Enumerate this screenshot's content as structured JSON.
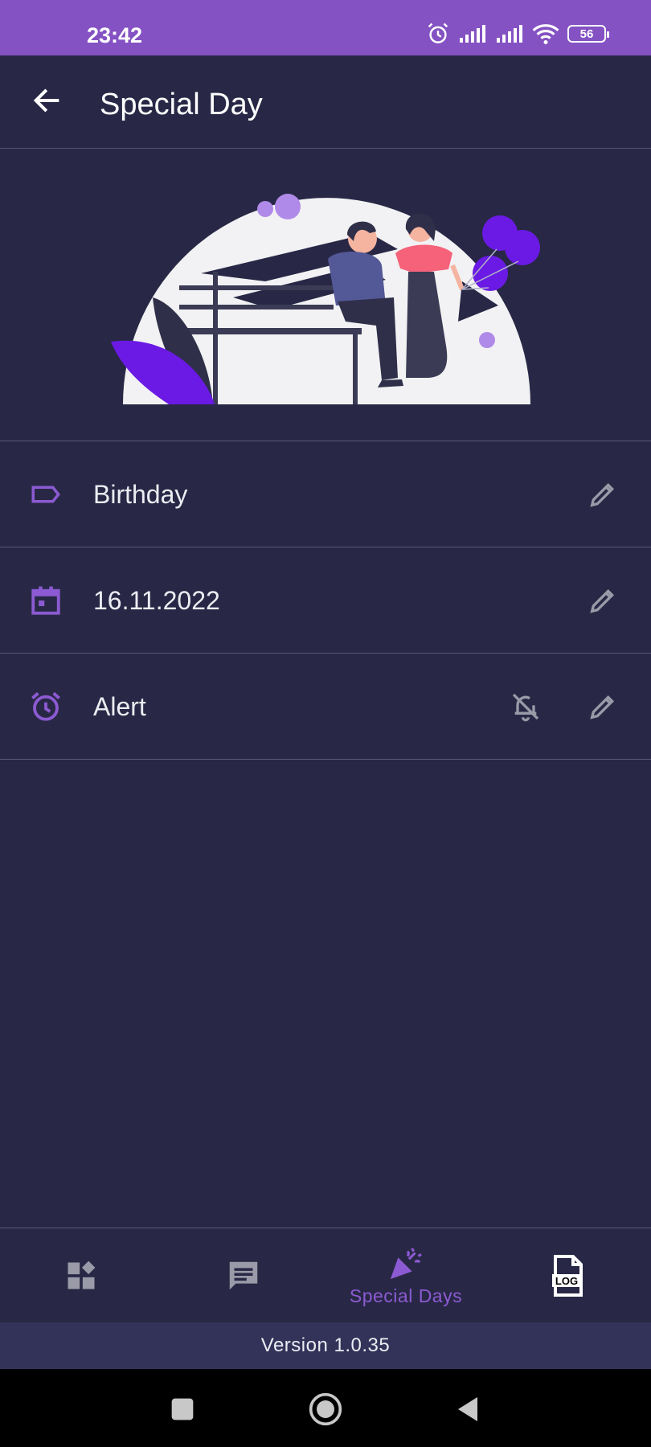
{
  "status_bar": {
    "time": "23:42",
    "battery": "56"
  },
  "app_bar": {
    "title": "Special Day"
  },
  "details": {
    "name": "Birthday",
    "date": "16.11.2022",
    "alert": "Alert"
  },
  "bottom_nav": {
    "items": [
      {
        "icon": "dashboard-icon",
        "label": ""
      },
      {
        "icon": "message-icon",
        "label": ""
      },
      {
        "icon": "celebration-icon",
        "label": "Special Days",
        "active": true
      },
      {
        "icon": "log-file-icon",
        "label": "LOG"
      }
    ]
  },
  "footer": {
    "version": "Version 1.0.35"
  },
  "colors": {
    "background": "#282846",
    "status_bar": "#8452c3",
    "accent": "#8c5ad2",
    "icon_gray": "#9a9aa8"
  }
}
